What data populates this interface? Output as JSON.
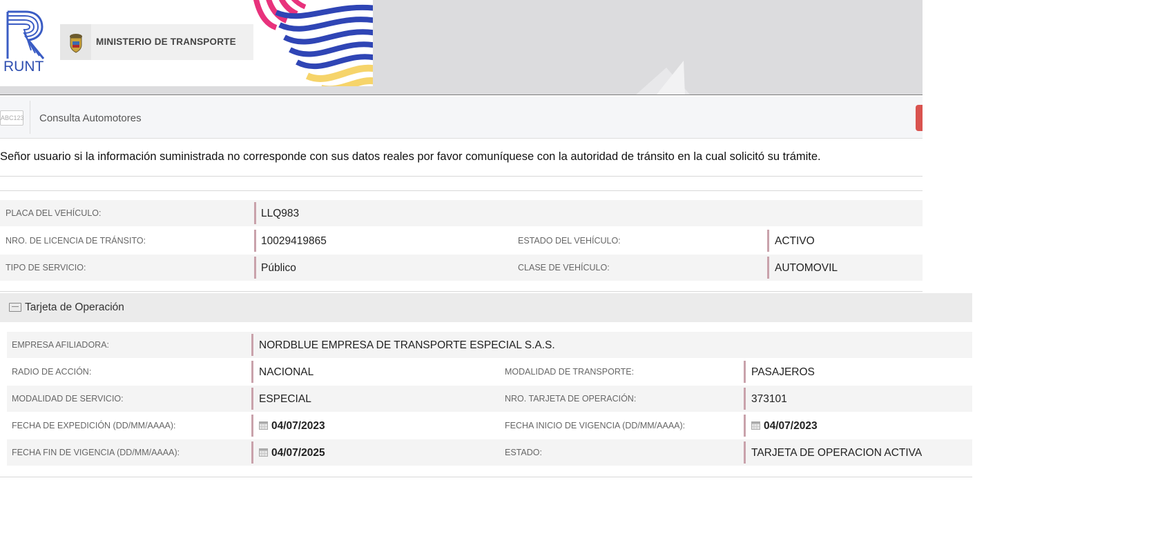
{
  "header": {
    "logo_text": "RUNT",
    "ministry": "MINISTERIO DE TRANSPORTE"
  },
  "toolbar": {
    "plate_icon_text": "ABC123",
    "title": "Consulta Automotores"
  },
  "notice": "Señor usuario si la información suministrada no corresponde con sus datos reales por favor comuníquese con la autoridad de tránsito en la cual solicitó su trámite.",
  "vehicle": {
    "placa_label": "PLACA DEL VEHÍCULO:",
    "placa": "LLQ983",
    "licencia_label": "NRO. DE LICENCIA DE TRÁNSITO:",
    "licencia": "10029419865",
    "estado_label": "ESTADO DEL VEHÍCULO:",
    "estado": "ACTIVO",
    "servicio_label": "TIPO DE SERVICIO:",
    "servicio": "Público",
    "clase_label": "CLASE DE VEHÍCULO:",
    "clase": "AUTOMOVIL"
  },
  "tarjeta": {
    "title": "Tarjeta de Operación",
    "empresa_label": "EMPRESA AFILIADORA:",
    "empresa": "NORDBLUE EMPRESA DE TRANSPORTE ESPECIAL S.A.S.",
    "radio_label": "RADIO DE ACCIÓN:",
    "radio": "NACIONAL",
    "modalidad_transporte_label": "MODALIDAD DE TRANSPORTE:",
    "modalidad_transporte": "PASAJEROS",
    "modalidad_servicio_label": "MODALIDAD DE SERVICIO:",
    "modalidad_servicio": "ESPECIAL",
    "nro_tarjeta_label": "NRO. TARJETA DE OPERACIÓN:",
    "nro_tarjeta": "373101",
    "fecha_expedicion_label": "FECHA DE EXPEDICIÓN (DD/MM/AAAA):",
    "fecha_expedicion": "04/07/2023",
    "fecha_inicio_label": "FECHA INICIO DE VIGENCIA (DD/MM/AAAA):",
    "fecha_inicio": "04/07/2023",
    "fecha_fin_label": "FECHA FIN DE VIGENCIA (DD/MM/AAAA):",
    "fecha_fin": "04/07/2025",
    "estado_label": "ESTADO:",
    "estado": "TARJETA DE OPERACION ACTIVA"
  },
  "icons": {
    "calendar": "calendar-icon",
    "id_card": "id-card-icon",
    "plate": "plate-icon"
  },
  "colors": {
    "accent_bar": "#c9a2ab",
    "runt_blue": "#2f4fb0",
    "red_button": "#d9534f"
  }
}
